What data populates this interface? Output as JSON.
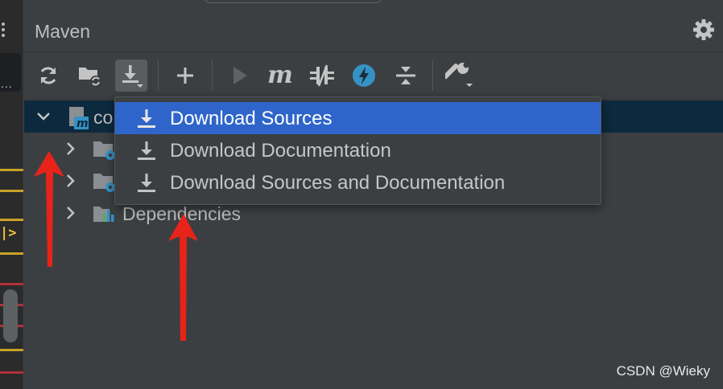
{
  "panel": {
    "title": "Maven",
    "settings_icon": "gear-icon"
  },
  "toolbar": {
    "buttons": [
      {
        "name": "reload-all-icon",
        "label": "Reload All Maven Projects"
      },
      {
        "name": "generate-sources-icon",
        "label": "Generate Sources and Update Folders"
      },
      {
        "name": "download-icon",
        "label": "Download Sources and/or Documentation"
      },
      {
        "name": "add-icon",
        "label": "Add Maven Projects"
      },
      {
        "name": "run-icon",
        "label": "Run Maven Build"
      },
      {
        "name": "maven-goal-icon",
        "label": "Execute Maven Goal",
        "text": "m"
      },
      {
        "name": "toggle-offline-icon",
        "label": "Toggle Offline Mode"
      },
      {
        "name": "skip-tests-icon",
        "label": "Toggle Skip Tests Mode"
      },
      {
        "name": "collapse-all-icon",
        "label": "Collapse All"
      },
      {
        "name": "build-tools-settings-icon",
        "label": "Build Tools Settings"
      }
    ]
  },
  "tree": {
    "root": {
      "label": "co",
      "icon": "maven-module-icon",
      "expanded": true
    },
    "children": [
      {
        "label": "",
        "icon": "lifecycle-folder-icon"
      },
      {
        "label": "",
        "icon": "plugins-folder-icon"
      },
      {
        "label": "Dependencies",
        "icon": "dependencies-icon"
      }
    ]
  },
  "dropdown": {
    "items": [
      {
        "label": "Download Sources",
        "icon": "download-icon",
        "selected": true
      },
      {
        "label": "Download Documentation",
        "icon": "download-icon",
        "selected": false
      },
      {
        "label": "Download Sources and Documentation",
        "icon": "download-icon",
        "selected": false
      }
    ]
  },
  "annotations": {
    "arrow_color": "#e8231a"
  },
  "watermark": "CSDN @Wieky",
  "colors": {
    "background": "#3c3f41",
    "selected_row": "#0d293e",
    "menu_highlight": "#2f65ca",
    "accent_blue": "#3592c4"
  }
}
